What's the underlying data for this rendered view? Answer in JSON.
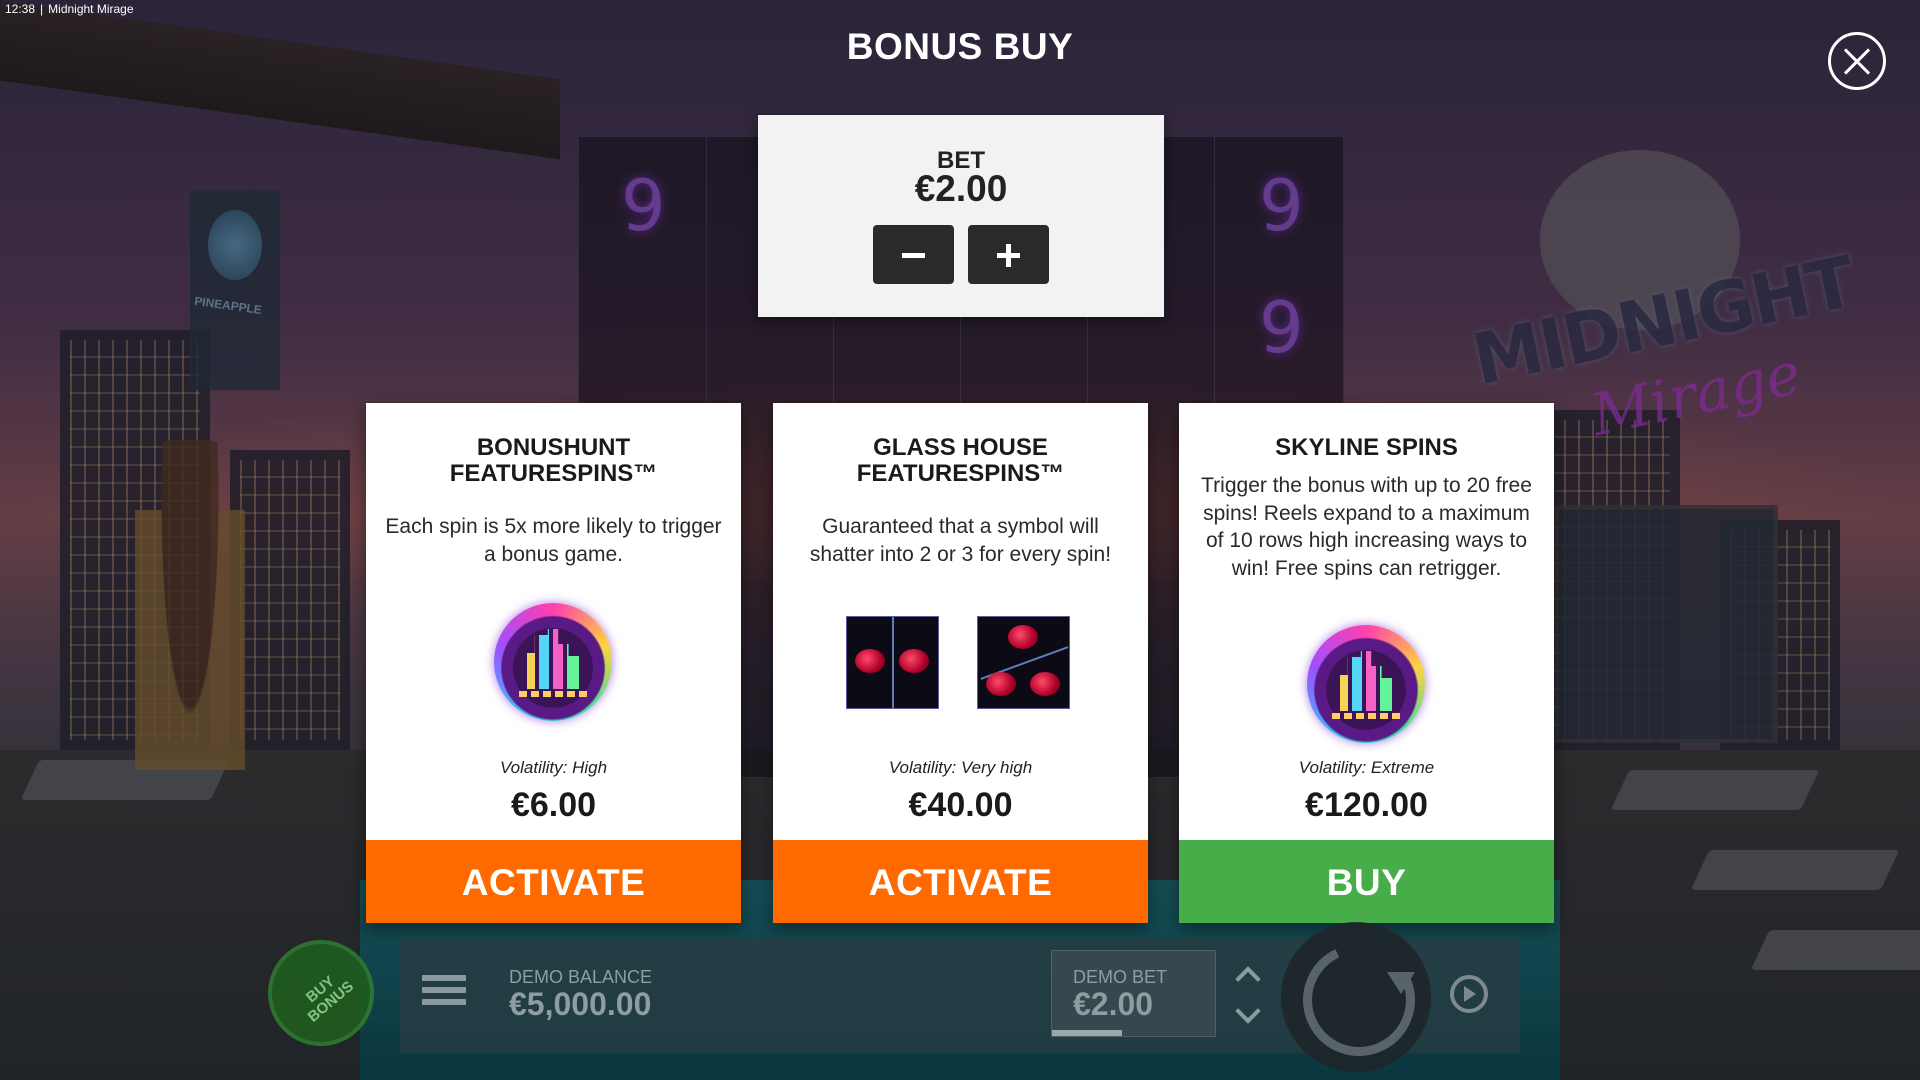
{
  "status_bar": {
    "time": "12:38",
    "app_title": "Midnight Mirage"
  },
  "header": {
    "title": "BONUS BUY",
    "close_icon": "close-icon"
  },
  "bet": {
    "label": "BET",
    "value": "€2.00",
    "decrease_icon": "minus-icon",
    "increase_icon": "plus-icon"
  },
  "cards": [
    {
      "title": "BONUSHUNT\nFEATURESPINS™",
      "description": "Each spin is 5x more likely to trigger a bonus game.",
      "image": "skyline-emblem-icon",
      "volatility": "Volatility: High",
      "price": "€6.00",
      "button_label": "ACTIVATE",
      "button_color": "#ff6a00"
    },
    {
      "title": "GLASS HOUSE\nFEATURESPINS™",
      "description": "Guaranteed that a symbol will shatter into 2 or 3 for every spin!",
      "image": "shattered-rose-tiles-icon",
      "volatility": "Volatility: Very high",
      "price": "€40.00",
      "button_label": "ACTIVATE",
      "button_color": "#ff6a00"
    },
    {
      "title": "SKYLINE SPINS",
      "description": "Trigger the bonus with up to 20 free spins! Reels expand to a maximum of 10 rows high increasing ways to win! Free spins can retrigger.",
      "image": "skyline-emblem-icon",
      "volatility": "Volatility: Extreme",
      "price": "€120.00",
      "button_label": "BUY",
      "button_color": "#46ad49"
    }
  ],
  "bottom_bar": {
    "buy_bonus_label": "BUY\nBONUS",
    "menu_icon": "hamburger-menu-icon",
    "balance_label": "DEMO BALANCE",
    "balance_value": "€5,000.00",
    "bet_label": "DEMO BET",
    "bet_value": "€2.00",
    "spin_icon": "spin-icon",
    "autoplay_icon": "autoplay-icon"
  },
  "background": {
    "game_logo_main": "MIDNIGHT",
    "game_logo_script": "Mirage",
    "sign_text": "PINEAPPLE"
  }
}
